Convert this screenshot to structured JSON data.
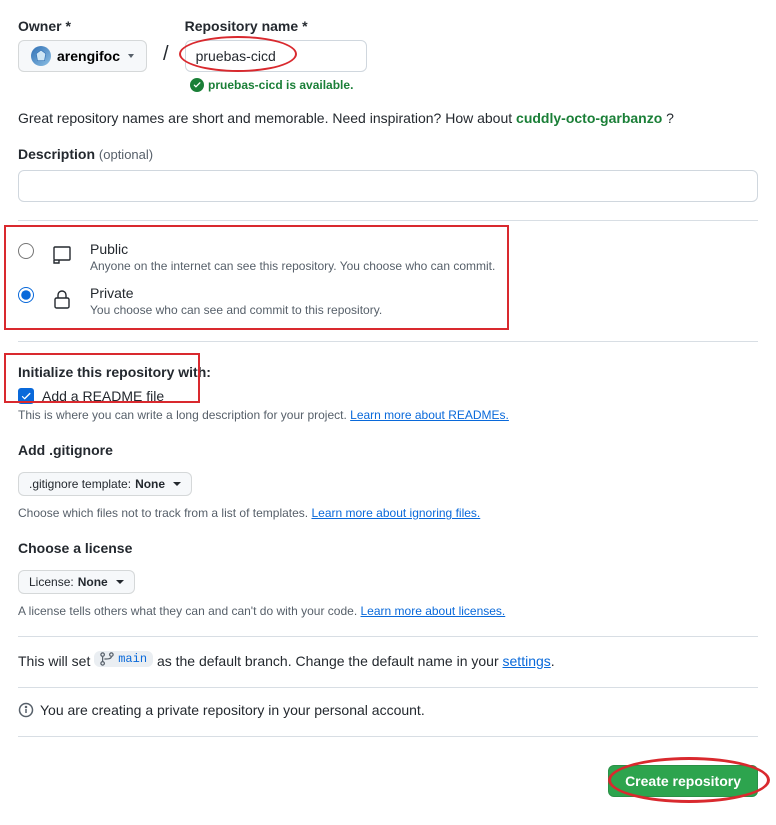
{
  "owner": {
    "label": "Owner",
    "required": "*",
    "name": "arengifoc"
  },
  "repo": {
    "label": "Repository name",
    "required": "*",
    "value": "pruebas-cicd",
    "available_text": "pruebas-cicd is available."
  },
  "hint": {
    "prefix": "Great repository names are short and memorable. Need inspiration? How about ",
    "suggestion": "cuddly-octo-garbanzo",
    "suffix": " ?"
  },
  "description": {
    "label": "Description",
    "optional": "(optional)",
    "value": ""
  },
  "visibility": {
    "public": {
      "title": "Public",
      "desc": "Anyone on the internet can see this repository. You choose who can commit."
    },
    "private": {
      "title": "Private",
      "desc": "You choose who can see and commit to this repository."
    },
    "selected": "private"
  },
  "init": {
    "heading": "Initialize this repository with:",
    "readme_label": "Add a README file",
    "readme_desc": "This is where you can write a long description for your project. ",
    "readme_link": "Learn more about READMEs."
  },
  "gitignore": {
    "heading": "Add .gitignore",
    "button_prefix": ".gitignore template: ",
    "button_value": "None",
    "desc": "Choose which files not to track from a list of templates. ",
    "link": "Learn more about ignoring files."
  },
  "license": {
    "heading": "Choose a license",
    "button_prefix": "License: ",
    "button_value": "None",
    "desc": "A license tells others what they can and can't do with your code. ",
    "link": "Learn more about licenses."
  },
  "branch": {
    "prefix": "This will set ",
    "name": "main",
    "mid": " as the default branch. Change the default name in your ",
    "link": "settings",
    "suffix": "."
  },
  "info_text": "You are creating a private repository in your personal account.",
  "create_button": "Create repository"
}
